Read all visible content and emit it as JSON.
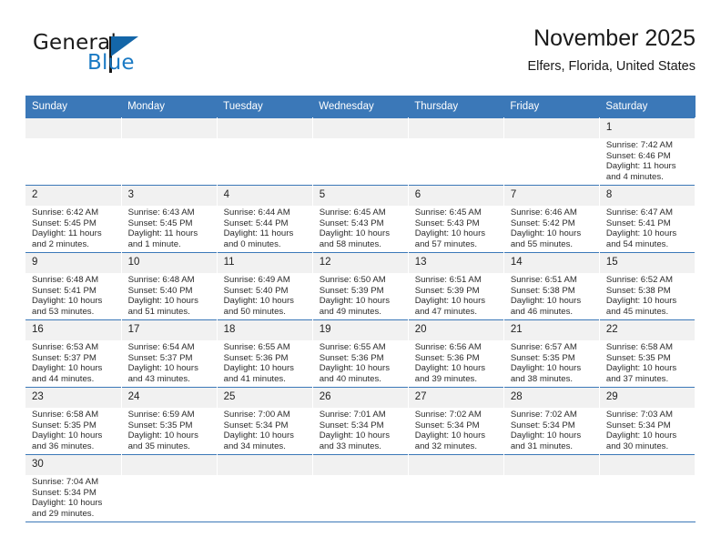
{
  "brand": {
    "name_part1": "General",
    "name_part2": "Blue"
  },
  "header": {
    "title": "November 2025",
    "subtitle": "Elfers, Florida, United States"
  },
  "colors": {
    "header_blue": "#3b78b8",
    "brand_blue": "#1b7ac4",
    "daynum_band": "#f1f1f1"
  },
  "weekday_headers": [
    "Sunday",
    "Monday",
    "Tuesday",
    "Wednesday",
    "Thursday",
    "Friday",
    "Saturday"
  ],
  "weeks": [
    [
      {
        "day": "",
        "empty": true
      },
      {
        "day": "",
        "empty": true
      },
      {
        "day": "",
        "empty": true
      },
      {
        "day": "",
        "empty": true
      },
      {
        "day": "",
        "empty": true
      },
      {
        "day": "",
        "empty": true
      },
      {
        "day": "1",
        "sunrise": "Sunrise: 7:42 AM",
        "sunset": "Sunset: 6:46 PM",
        "daylight1": "Daylight: 11 hours",
        "daylight2": "and 4 minutes."
      }
    ],
    [
      {
        "day": "2",
        "sunrise": "Sunrise: 6:42 AM",
        "sunset": "Sunset: 5:45 PM",
        "daylight1": "Daylight: 11 hours",
        "daylight2": "and 2 minutes."
      },
      {
        "day": "3",
        "sunrise": "Sunrise: 6:43 AM",
        "sunset": "Sunset: 5:45 PM",
        "daylight1": "Daylight: 11 hours",
        "daylight2": "and 1 minute."
      },
      {
        "day": "4",
        "sunrise": "Sunrise: 6:44 AM",
        "sunset": "Sunset: 5:44 PM",
        "daylight1": "Daylight: 11 hours",
        "daylight2": "and 0 minutes."
      },
      {
        "day": "5",
        "sunrise": "Sunrise: 6:45 AM",
        "sunset": "Sunset: 5:43 PM",
        "daylight1": "Daylight: 10 hours",
        "daylight2": "and 58 minutes."
      },
      {
        "day": "6",
        "sunrise": "Sunrise: 6:45 AM",
        "sunset": "Sunset: 5:43 PM",
        "daylight1": "Daylight: 10 hours",
        "daylight2": "and 57 minutes."
      },
      {
        "day": "7",
        "sunrise": "Sunrise: 6:46 AM",
        "sunset": "Sunset: 5:42 PM",
        "daylight1": "Daylight: 10 hours",
        "daylight2": "and 55 minutes."
      },
      {
        "day": "8",
        "sunrise": "Sunrise: 6:47 AM",
        "sunset": "Sunset: 5:41 PM",
        "daylight1": "Daylight: 10 hours",
        "daylight2": "and 54 minutes."
      }
    ],
    [
      {
        "day": "9",
        "sunrise": "Sunrise: 6:48 AM",
        "sunset": "Sunset: 5:41 PM",
        "daylight1": "Daylight: 10 hours",
        "daylight2": "and 53 minutes."
      },
      {
        "day": "10",
        "sunrise": "Sunrise: 6:48 AM",
        "sunset": "Sunset: 5:40 PM",
        "daylight1": "Daylight: 10 hours",
        "daylight2": "and 51 minutes."
      },
      {
        "day": "11",
        "sunrise": "Sunrise: 6:49 AM",
        "sunset": "Sunset: 5:40 PM",
        "daylight1": "Daylight: 10 hours",
        "daylight2": "and 50 minutes."
      },
      {
        "day": "12",
        "sunrise": "Sunrise: 6:50 AM",
        "sunset": "Sunset: 5:39 PM",
        "daylight1": "Daylight: 10 hours",
        "daylight2": "and 49 minutes."
      },
      {
        "day": "13",
        "sunrise": "Sunrise: 6:51 AM",
        "sunset": "Sunset: 5:39 PM",
        "daylight1": "Daylight: 10 hours",
        "daylight2": "and 47 minutes."
      },
      {
        "day": "14",
        "sunrise": "Sunrise: 6:51 AM",
        "sunset": "Sunset: 5:38 PM",
        "daylight1": "Daylight: 10 hours",
        "daylight2": "and 46 minutes."
      },
      {
        "day": "15",
        "sunrise": "Sunrise: 6:52 AM",
        "sunset": "Sunset: 5:38 PM",
        "daylight1": "Daylight: 10 hours",
        "daylight2": "and 45 minutes."
      }
    ],
    [
      {
        "day": "16",
        "sunrise": "Sunrise: 6:53 AM",
        "sunset": "Sunset: 5:37 PM",
        "daylight1": "Daylight: 10 hours",
        "daylight2": "and 44 minutes."
      },
      {
        "day": "17",
        "sunrise": "Sunrise: 6:54 AM",
        "sunset": "Sunset: 5:37 PM",
        "daylight1": "Daylight: 10 hours",
        "daylight2": "and 43 minutes."
      },
      {
        "day": "18",
        "sunrise": "Sunrise: 6:55 AM",
        "sunset": "Sunset: 5:36 PM",
        "daylight1": "Daylight: 10 hours",
        "daylight2": "and 41 minutes."
      },
      {
        "day": "19",
        "sunrise": "Sunrise: 6:55 AM",
        "sunset": "Sunset: 5:36 PM",
        "daylight1": "Daylight: 10 hours",
        "daylight2": "and 40 minutes."
      },
      {
        "day": "20",
        "sunrise": "Sunrise: 6:56 AM",
        "sunset": "Sunset: 5:36 PM",
        "daylight1": "Daylight: 10 hours",
        "daylight2": "and 39 minutes."
      },
      {
        "day": "21",
        "sunrise": "Sunrise: 6:57 AM",
        "sunset": "Sunset: 5:35 PM",
        "daylight1": "Daylight: 10 hours",
        "daylight2": "and 38 minutes."
      },
      {
        "day": "22",
        "sunrise": "Sunrise: 6:58 AM",
        "sunset": "Sunset: 5:35 PM",
        "daylight1": "Daylight: 10 hours",
        "daylight2": "and 37 minutes."
      }
    ],
    [
      {
        "day": "23",
        "sunrise": "Sunrise: 6:58 AM",
        "sunset": "Sunset: 5:35 PM",
        "daylight1": "Daylight: 10 hours",
        "daylight2": "and 36 minutes."
      },
      {
        "day": "24",
        "sunrise": "Sunrise: 6:59 AM",
        "sunset": "Sunset: 5:35 PM",
        "daylight1": "Daylight: 10 hours",
        "daylight2": "and 35 minutes."
      },
      {
        "day": "25",
        "sunrise": "Sunrise: 7:00 AM",
        "sunset": "Sunset: 5:34 PM",
        "daylight1": "Daylight: 10 hours",
        "daylight2": "and 34 minutes."
      },
      {
        "day": "26",
        "sunrise": "Sunrise: 7:01 AM",
        "sunset": "Sunset: 5:34 PM",
        "daylight1": "Daylight: 10 hours",
        "daylight2": "and 33 minutes."
      },
      {
        "day": "27",
        "sunrise": "Sunrise: 7:02 AM",
        "sunset": "Sunset: 5:34 PM",
        "daylight1": "Daylight: 10 hours",
        "daylight2": "and 32 minutes."
      },
      {
        "day": "28",
        "sunrise": "Sunrise: 7:02 AM",
        "sunset": "Sunset: 5:34 PM",
        "daylight1": "Daylight: 10 hours",
        "daylight2": "and 31 minutes."
      },
      {
        "day": "29",
        "sunrise": "Sunrise: 7:03 AM",
        "sunset": "Sunset: 5:34 PM",
        "daylight1": "Daylight: 10 hours",
        "daylight2": "and 30 minutes."
      }
    ],
    [
      {
        "day": "30",
        "sunrise": "Sunrise: 7:04 AM",
        "sunset": "Sunset: 5:34 PM",
        "daylight1": "Daylight: 10 hours",
        "daylight2": "and 29 minutes."
      },
      {
        "day": "",
        "empty": true
      },
      {
        "day": "",
        "empty": true
      },
      {
        "day": "",
        "empty": true
      },
      {
        "day": "",
        "empty": true
      },
      {
        "day": "",
        "empty": true
      },
      {
        "day": "",
        "empty": true
      }
    ]
  ]
}
